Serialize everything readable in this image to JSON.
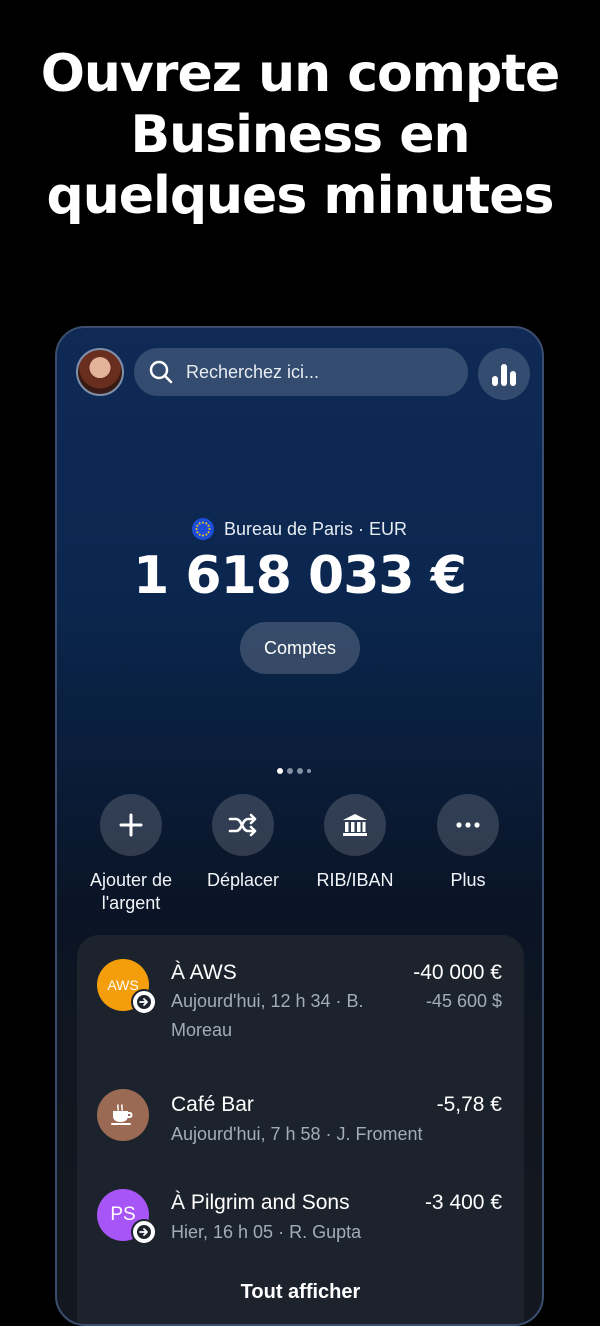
{
  "headline": {
    "line1": "Ouvrez un compte",
    "line2": "Business en",
    "line3": "quelques minutes"
  },
  "header": {
    "search_placeholder": "Recherchez ici..."
  },
  "account": {
    "name": "Bureau de Paris · EUR",
    "balance": "1 618 033 €",
    "accounts_button": "Comptes"
  },
  "pager": {
    "pages": 4,
    "current": 1
  },
  "actions": [
    {
      "label": "Ajouter de l'argent",
      "icon": "plus-icon"
    },
    {
      "label": "Déplacer",
      "icon": "shuffle-icon"
    },
    {
      "label": "RIB/IBAN",
      "icon": "bank-icon"
    },
    {
      "label": "Plus",
      "icon": "more-icon"
    }
  ],
  "transactions": [
    {
      "logo_text": "AWS",
      "logo_color": "#f59e0b",
      "title": "À AWS",
      "subtitle": "Aujourd'hui, 12 h 34 · B. Moreau",
      "amount": "-40 000 €",
      "amount_secondary": "-45 600 $",
      "badge": "arrow-right-icon"
    },
    {
      "logo_text": "",
      "logo_color": "#9b6a55",
      "logo_icon": "coffee-cup-icon",
      "title": "Café Bar",
      "subtitle": "Aujourd'hui, 7 h 58 · J. Froment",
      "amount": "-5,78 €"
    },
    {
      "logo_text": "PS",
      "logo_color": "#a855f7",
      "title": "À Pilgrim and Sons",
      "subtitle": "Hier, 16 h 05 · R. Gupta",
      "amount": "-3 400 €",
      "badge": "arrow-right-icon"
    }
  ],
  "show_all": "Tout afficher",
  "colors": {
    "background": "#000000",
    "phone_top": "#0e2a55",
    "card": "#1d232c",
    "aws": "#f59e0b",
    "cafe": "#9b6a55",
    "pilgrim": "#a855f7"
  }
}
